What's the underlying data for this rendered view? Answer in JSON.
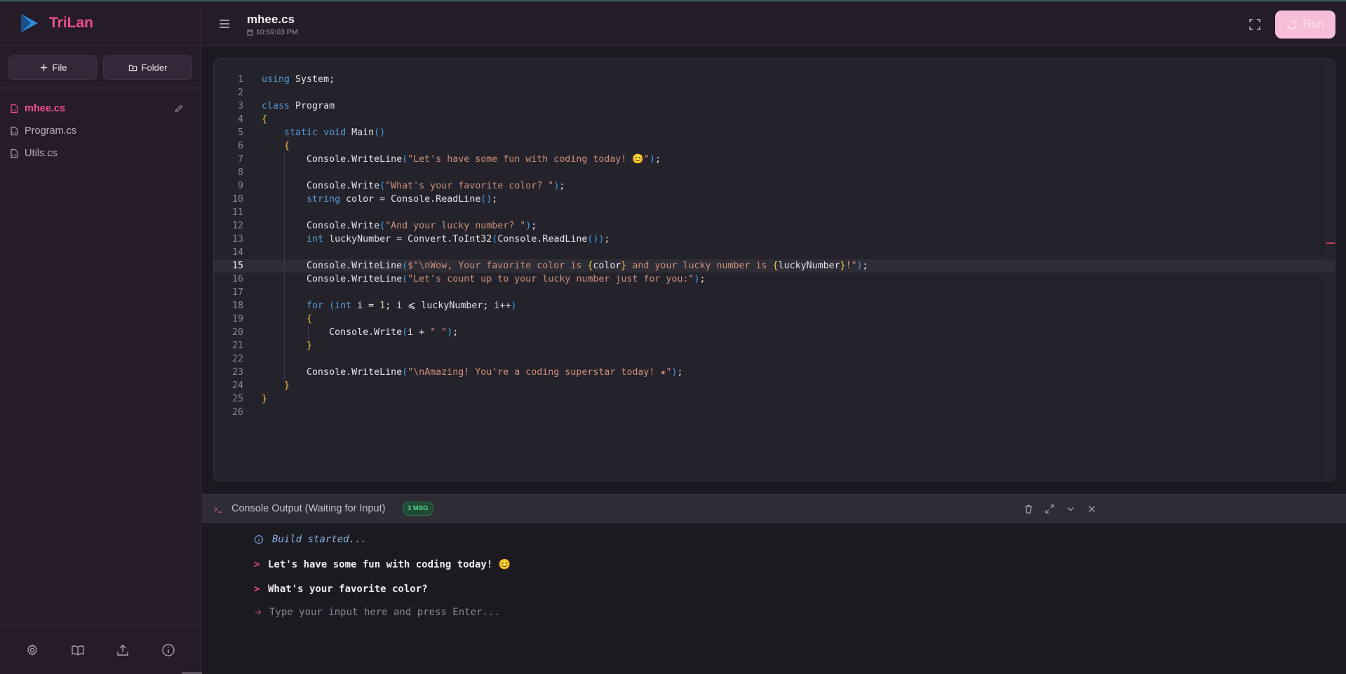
{
  "app": {
    "name": "TriLan"
  },
  "sidebar": {
    "new_file_label": "File",
    "new_folder_label": "Folder",
    "files": [
      {
        "name": "mhee.cs",
        "active": true
      },
      {
        "name": "Program.cs",
        "active": false
      },
      {
        "name": "Utils.cs",
        "active": false
      }
    ],
    "bottom_icons": [
      "settings-icon",
      "book-icon",
      "upload-icon",
      "info-icon"
    ]
  },
  "header": {
    "title": "mhee.cs",
    "time": "10:59:03 PM",
    "run_label": "Run"
  },
  "editor": {
    "current_line": 15,
    "lines": [
      "using System;",
      "",
      "class Program",
      "{",
      "    static void Main()",
      "    {",
      "        Console.WriteLine(\"Let's have some fun with coding today! 😊\");",
      "",
      "        Console.Write(\"What's your favorite color? \");",
      "        string color = Console.ReadLine();",
      "",
      "        Console.Write(\"And your lucky number? \");",
      "        int luckyNumber = Convert.ToInt32(Console.ReadLine());",
      "",
      "        Console.WriteLine($\"\\nWow, Your favorite color is {color} and your lucky number is {luckyNumber}!\");",
      "        Console.WriteLine(\"Let's count up to your lucky number just for you:\");",
      "",
      "        for (int i = 1; i ⩽ luckyNumber; i++)",
      "        {",
      "            Console.Write(i + \" \");",
      "        }",
      "",
      "        Console.WriteLine(\"\\nAmazing! You're a coding superstar today! ★\");",
      "    }",
      "}",
      ""
    ]
  },
  "console": {
    "title": "Console Output (Waiting for Input)",
    "badge": "3 MSG",
    "build_message": "Build started...",
    "outputs": [
      "Let's have some fun with coding today! 😊",
      "What's your favorite color?"
    ],
    "input_placeholder": "Type your input here and press Enter...",
    "colors": {
      "accent": "#ec4f8e",
      "badge": "#58d38a"
    }
  }
}
